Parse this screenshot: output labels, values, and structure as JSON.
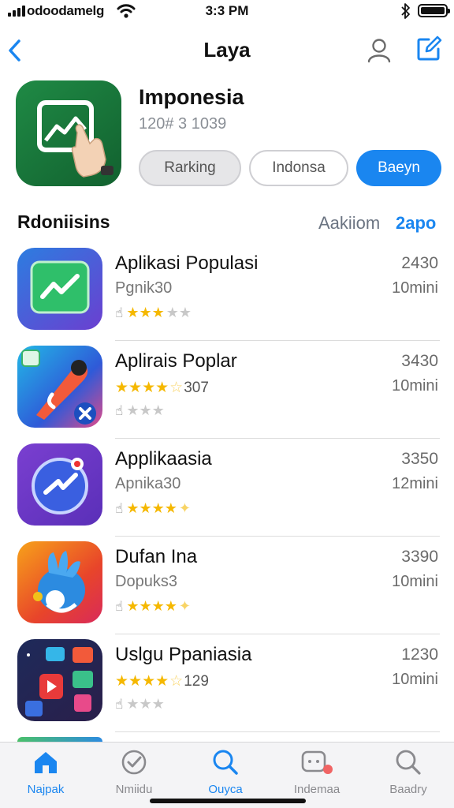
{
  "status_bar": {
    "carrier": "odoodamelg",
    "time": "3:3 PM"
  },
  "nav": {
    "title": "Laya"
  },
  "featured": {
    "title": "Imponesia",
    "subtitle": "120# 3 1039",
    "chips": [
      "Rarking",
      "Indonsa",
      "Baeyn"
    ]
  },
  "section": {
    "title": "Rdoniisins",
    "link_secondary": "Aakiiom",
    "link_primary": "2apo"
  },
  "apps": [
    {
      "name": "Aplikasi Populasi",
      "subtitle": "Pgnik30",
      "rating_text": "",
      "stars": 3,
      "meta1": "2430",
      "meta2": "10mini"
    },
    {
      "name": "Aplirais Poplar",
      "subtitle": "",
      "rating_text": "307",
      "stars": 3,
      "meta1": "3430",
      "meta2": "10mini"
    },
    {
      "name": "Applikaasia",
      "subtitle": "Apnika30",
      "rating_text": "",
      "stars": 4,
      "meta1": "3350",
      "meta2": "12mini"
    },
    {
      "name": "Dufan Ina",
      "subtitle": "Dopuks3",
      "rating_text": "",
      "stars": 4,
      "meta1": "3390",
      "meta2": "10mini"
    },
    {
      "name": "Uslgu Ppaniasia",
      "subtitle": "",
      "rating_text": "129",
      "stars": 3,
      "meta1": "1230",
      "meta2": "10mini"
    }
  ],
  "tabs": [
    {
      "label": "Najpak",
      "icon": "home-icon",
      "active": true
    },
    {
      "label": "Nmiidu",
      "icon": "check-badge-icon",
      "active": false
    },
    {
      "label": "Ouyca",
      "icon": "search-icon",
      "active": false
    },
    {
      "label": "Indemaa",
      "icon": "chat-icon",
      "active": false
    },
    {
      "label": "Baadry",
      "icon": "search-icon",
      "active": false
    }
  ],
  "colors": {
    "accent": "#1a86f0",
    "star": "#f5b800",
    "featured_icon": "#1f8a45"
  }
}
